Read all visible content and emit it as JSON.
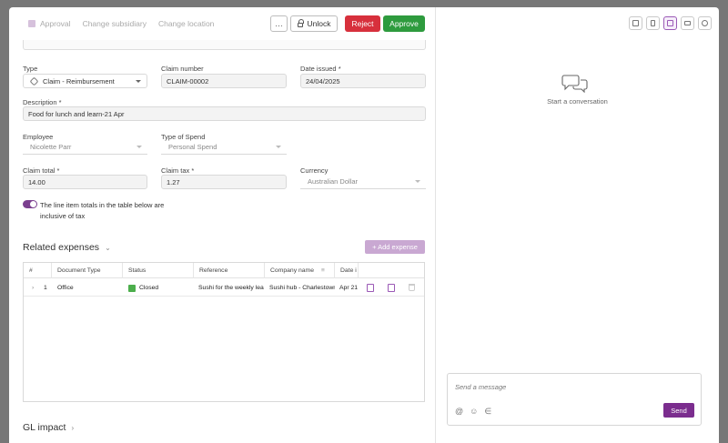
{
  "topbar": {
    "actions": [
      {
        "label": "Approval"
      },
      {
        "label": "Change subsidiary"
      },
      {
        "label": "Change location"
      }
    ],
    "more_label": "…",
    "unlock_label": "Unlock",
    "reject_label": "Reject",
    "approve_label": "Approve"
  },
  "form": {
    "type": {
      "label": "Type",
      "value": "Claim - Reimbursement"
    },
    "claim_number": {
      "label": "Claim number",
      "value": "CLAIM-00002"
    },
    "date_issued": {
      "label": "Date issued *",
      "value": "24/04/2025"
    },
    "description": {
      "label": "Description *",
      "value": "Food for lunch and learn-21 Apr"
    },
    "employee": {
      "label": "Employee",
      "value": "Nicolette Parr"
    },
    "type_of_spend": {
      "label": "Type of Spend",
      "value": "Personal Spend"
    },
    "claim_total": {
      "label": "Claim total *",
      "value": "14.00"
    },
    "claim_tax": {
      "label": "Claim tax *",
      "value": "1.27"
    },
    "currency": {
      "label": "Currency",
      "value": "Australian Dollar"
    },
    "tax_inclusive": {
      "label": "The line item totals in the table below are inclusive of tax",
      "on": true
    }
  },
  "related_expenses": {
    "title": "Related expenses",
    "add_label": "+ Add expense",
    "columns": [
      "#",
      "Document Type",
      "Status",
      "Reference",
      "Company name",
      "Date i"
    ],
    "rows": [
      {
        "expand": "›",
        "num": "1",
        "doc_type": "Office",
        "status": "Closed",
        "reference": "Sushi for the weekly lear",
        "company": "Sushi hub - Charlestown",
        "date": "Apr 21,"
      }
    ]
  },
  "gl_impact": {
    "title": "GL impact"
  },
  "sidebar": {
    "empty_text": "Start a conversation",
    "message_placeholder": "Send a message",
    "send_label": "Send"
  },
  "colors": {
    "accent": "#7b2d8e",
    "reject": "#d7303c",
    "approve": "#2e9b3e",
    "status_closed": "#4cae4c"
  }
}
